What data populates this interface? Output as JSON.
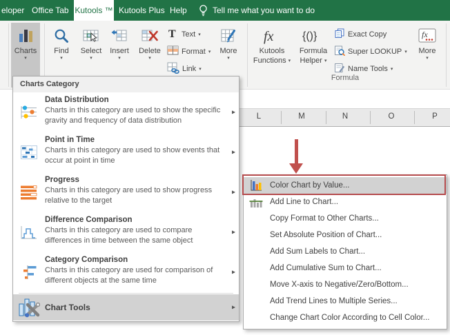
{
  "colors": {
    "excel_green": "#217346",
    "ribbon_bg": "#f3f3f2",
    "pressed_gray": "#c6c6c6",
    "menu_highlight": "#d2d2d2",
    "red_accent": "#c0504d",
    "icon_blue": "#2e75b6",
    "icon_orange": "#ed7d31",
    "icon_yellow": "#ffc000"
  },
  "glyphs": {
    "caret": "▾",
    "submenu_arrow": "▸"
  },
  "tab_bar": {
    "partial_left_tab": "eloper",
    "office_tab": "Office Tab",
    "kutools_tab": "Kutools ™",
    "kutools_plus_tab": "Kutools Plus",
    "help_tab": "Help",
    "tell_me": "Tell me what you want to do"
  },
  "ribbon": {
    "charts": "Charts",
    "find": "Find",
    "select": "Select",
    "insert": "Insert",
    "delete": "Delete",
    "text": "Text",
    "format": "Format",
    "link": "Link",
    "more_left": "More",
    "kutools_functions_line1": "Kutools",
    "kutools_functions_line2": "Functions",
    "formula_helper_line1": "Formula",
    "formula_helper_line2": "Helper",
    "exact_copy": "Exact Copy",
    "super_lookup": "Super LOOKUP",
    "name_tools": "Name Tools",
    "more_right": "More",
    "formula_group": "Formula"
  },
  "sheet": {
    "columns": [
      "L",
      "M",
      "N",
      "O",
      "P"
    ]
  },
  "charts_menu": {
    "header": "Charts Category",
    "items": [
      {
        "title": "Data Distribution",
        "desc": "Charts in this category are used to show the specific gravity and frequency of data distribution",
        "icon": "dot-plot-icon"
      },
      {
        "title": "Point in Time",
        "desc": "Charts in this category are used to show events that occur at point in time",
        "icon": "gantt-icon"
      },
      {
        "title": "Progress",
        "desc": "Charts in this category are used to show progress relative to the target",
        "icon": "progress-bars-icon"
      },
      {
        "title": "Difference Comparison",
        "desc": "Charts in this category are used to compare differences in time between the same object",
        "icon": "step-line-icon"
      },
      {
        "title": "Category Comparison",
        "desc": "Charts in this category are used for comparison of different objects at the same time",
        "icon": "tornado-bars-icon"
      }
    ],
    "chart_tools": {
      "title": "Chart Tools",
      "icon": "chart-tools-icon"
    }
  },
  "submenu": {
    "items": [
      {
        "label": "Color Chart by Value...",
        "icon": "color-chart-icon",
        "highlighted": true
      },
      {
        "label": "Add Line to Chart...",
        "icon": "add-line-icon",
        "highlighted": false
      },
      {
        "label": "Copy Format to Other Charts...",
        "highlighted": false
      },
      {
        "label": "Set Absolute Position of Chart...",
        "highlighted": false
      },
      {
        "label": "Add Sum Labels to Chart...",
        "highlighted": false
      },
      {
        "label": "Add Cumulative Sum to Chart...",
        "highlighted": false
      },
      {
        "label": "Move X-axis to Negative/Zero/Bottom...",
        "highlighted": false
      },
      {
        "label": "Add Trend Lines to Multiple Series...",
        "highlighted": false
      },
      {
        "label": "Change Chart Color According to Cell Color...",
        "highlighted": false
      }
    ]
  }
}
